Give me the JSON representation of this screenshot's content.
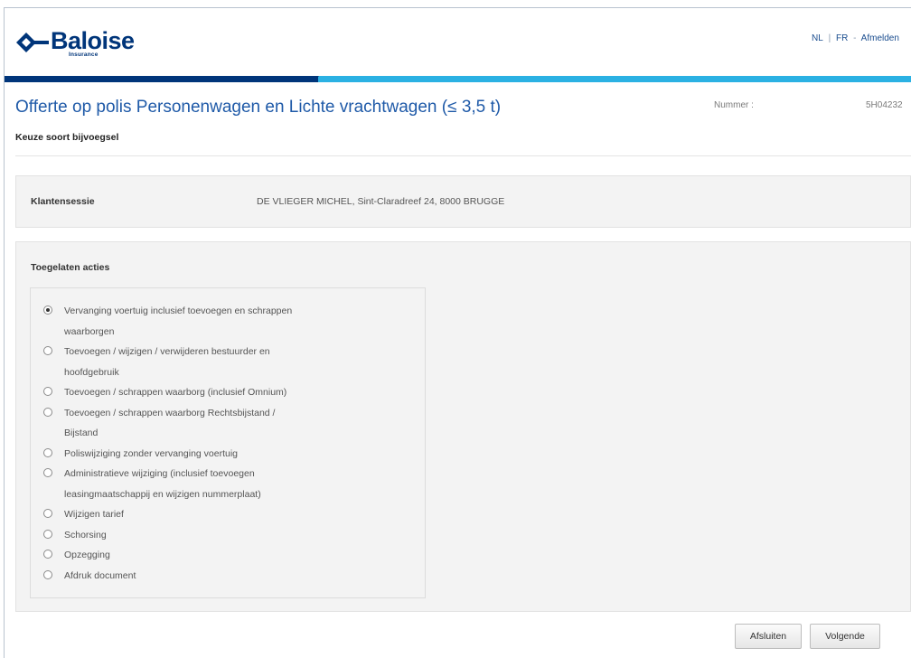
{
  "header": {
    "logo_name": "Baloise",
    "logo_sub": "Insurance",
    "lang_nl": "NL",
    "lang_fr": "FR",
    "logout": "Afmelden",
    "separator_1": "|",
    "separator_2": "-"
  },
  "colors": {
    "brand_dark": "#00357a",
    "brand_light": "#2bb1e3",
    "title_blue": "#1f5aa8"
  },
  "page": {
    "title": "Offerte op polis Personenwagen en Lichte vrachtwagen (≤ 3,5 t)",
    "nummer_label": "Nummer :",
    "nummer_value": "5H04232",
    "subtitle": "Keuze soort bijvoegsel"
  },
  "klant": {
    "label": "Klantensessie",
    "value": "DE VLIEGER MICHEL, Sint-Claradreef 24, 8000 BRUGGE"
  },
  "acties": {
    "label": "Toegelaten acties",
    "selected_index": 0,
    "options": [
      {
        "line1": "Vervanging voertuig inclusief toevoegen en schrappen",
        "line2": "waarborgen"
      },
      {
        "line1": "Toevoegen / wijzigen / verwijderen bestuurder en",
        "line2": "hoofdgebruik"
      },
      {
        "line1": "Toevoegen / schrappen waarborg (inclusief Omnium)",
        "line2": ""
      },
      {
        "line1": "Toevoegen / schrappen waarborg Rechtsbijstand /",
        "line2": "Bijstand"
      },
      {
        "line1": "Poliswijziging zonder vervanging voertuig",
        "line2": ""
      },
      {
        "line1": "Administratieve wijziging (inclusief toevoegen",
        "line2": "leasingmaatschappij en wijzigen nummerplaat)"
      },
      {
        "line1": "Wijzigen tarief",
        "line2": ""
      },
      {
        "line1": "Schorsing",
        "line2": ""
      },
      {
        "line1": "Opzegging",
        "line2": ""
      },
      {
        "line1": "Afdruk document",
        "line2": ""
      }
    ]
  },
  "buttons": {
    "close": "Afsluiten",
    "next": "Volgende"
  },
  "icons": {
    "logo": "baloise-logo-icon",
    "radio_selected": "radio-selected-icon",
    "radio_unselected": "radio-unselected-icon"
  }
}
